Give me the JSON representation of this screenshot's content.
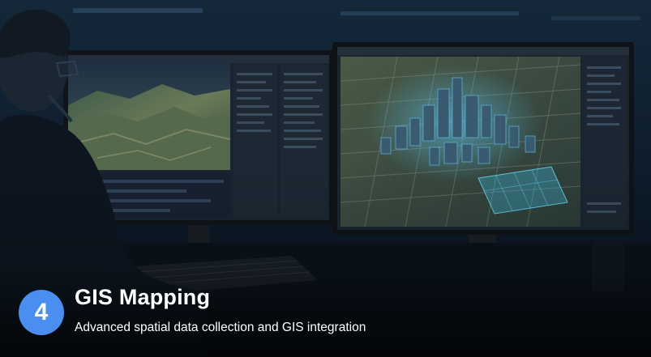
{
  "step_number": "4",
  "title": "GIS Mapping",
  "subtitle": "Advanced spatial data collection and GIS integration",
  "colors": {
    "badge": "#4a8ff0",
    "background": "#0a1522",
    "map_highlight": "#3fb8e0"
  },
  "icons": [
    "user-silhouette",
    "monitor-left",
    "monitor-right",
    "terrain-map",
    "3d-city-map",
    "keyboard"
  ]
}
